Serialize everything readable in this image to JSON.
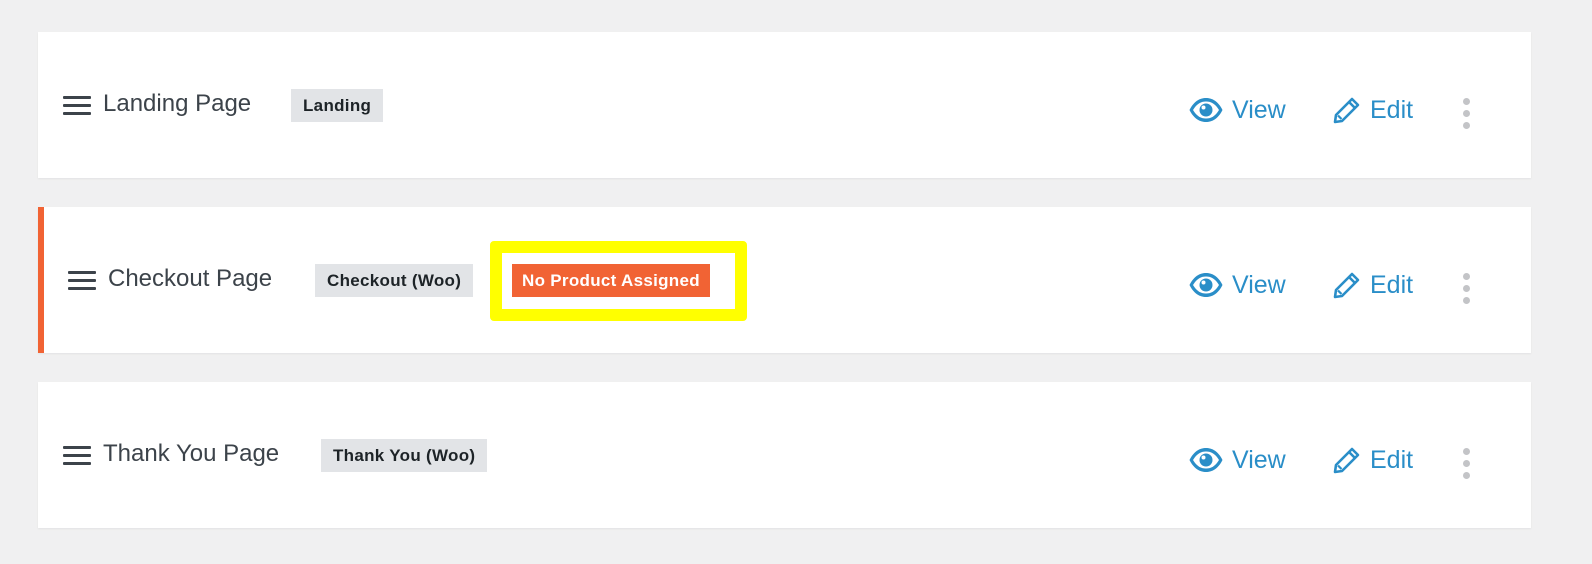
{
  "steps": [
    {
      "title": "Landing Page",
      "tag": "Landing",
      "view_label": "View",
      "edit_label": "Edit"
    },
    {
      "title": "Checkout Page",
      "tag": "Checkout (Woo)",
      "warning": "No Product Assigned",
      "view_label": "View",
      "edit_label": "Edit"
    },
    {
      "title": "Thank You Page",
      "tag": "Thank You (Woo)",
      "view_label": "View",
      "edit_label": "Edit"
    }
  ],
  "icons": {
    "drag": "drag-handle-icon",
    "view": "eye-icon",
    "edit": "pencil-icon",
    "more": "more-vertical-icon"
  },
  "colors": {
    "accent": "#2a8ec8",
    "warning": "#f16334",
    "highlight": "#ffff00",
    "tag_bg": "#e2e4e7",
    "page_bg": "#f0f0f1"
  }
}
